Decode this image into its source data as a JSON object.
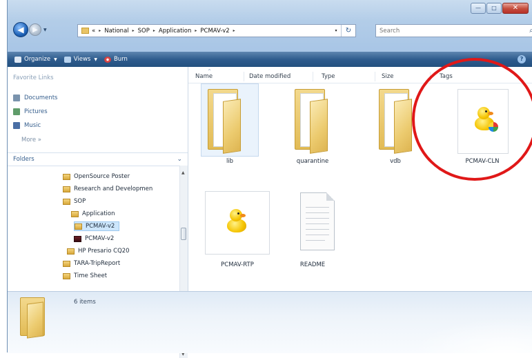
{
  "window": {
    "caption_buttons": {
      "minimize": "—",
      "maximize": "□",
      "close": "✕"
    }
  },
  "nav": {
    "back_glyph": "◀",
    "forward_glyph": "▶",
    "dropdown_glyph": "▼"
  },
  "address": {
    "prefix": "«",
    "crumbs": [
      "National",
      "SOP",
      "Application",
      "PCMAV-v2"
    ],
    "separator": "▸",
    "dropdown_glyph": "▾",
    "refresh_glyph": "↻"
  },
  "search": {
    "placeholder": "Search",
    "icon": "magnifier-icon"
  },
  "toolbar": {
    "organize": "Organize",
    "views": "Views",
    "burn": "Burn",
    "help": "?"
  },
  "sidebar": {
    "favorite_links_title": "Favorite Links",
    "favorites": [
      {
        "label": "Documents",
        "icon": "documents-icon"
      },
      {
        "label": "Pictures",
        "icon": "pictures-icon"
      },
      {
        "label": "Music",
        "icon": "music-icon"
      }
    ],
    "more": "More »",
    "folders_title": "Folders",
    "folders_chevron": "⌄",
    "tree": [
      {
        "label": "OpenSource Poster"
      },
      {
        "label": "Research and Developmen"
      },
      {
        "label": "SOP"
      },
      {
        "label": "Application"
      },
      {
        "label": "PCMAV-v2"
      },
      {
        "label": "PCMAV-v2"
      },
      {
        "label": "HP Presario CQ20"
      },
      {
        "label": "TARA-TripReport"
      },
      {
        "label": "Time Sheet"
      }
    ]
  },
  "columns": {
    "name": "Name",
    "date_modified": "Date modified",
    "type": "Type",
    "size": "Size",
    "tags": "Tags",
    "sort_glyph": "^"
  },
  "files": [
    {
      "label": "lib",
      "kind": "folder"
    },
    {
      "label": "quarantine",
      "kind": "folder"
    },
    {
      "label": "vdb",
      "kind": "folder"
    },
    {
      "label": "PCMAV-CLN",
      "kind": "application"
    },
    {
      "label": "PCMAV-RTP",
      "kind": "application"
    },
    {
      "label": "README",
      "kind": "document"
    }
  ],
  "details": {
    "item_count": "6 items"
  },
  "colors": {
    "toolbar": "#2f5c8e",
    "highlight_circle": "#e01818",
    "selection": "#cde6fb"
  }
}
